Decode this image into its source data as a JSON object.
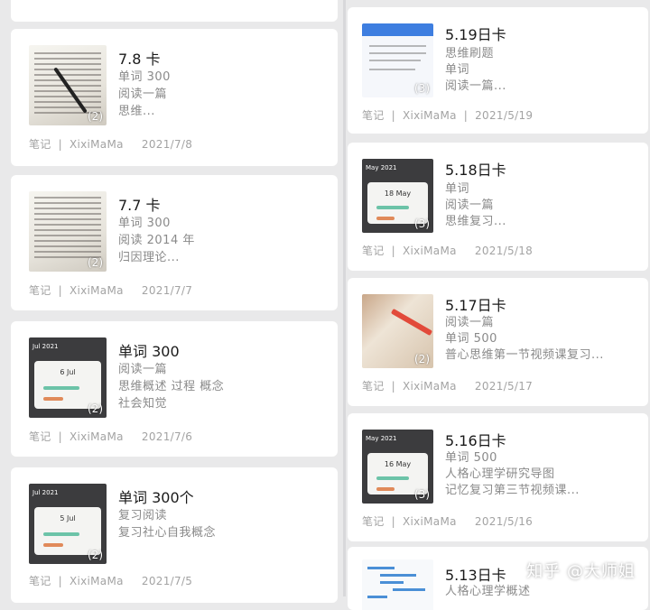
{
  "left_cards": [
    {
      "title": "7.8 卡",
      "lines": [
        "单词 300",
        "阅读一篇",
        "思维..."
      ],
      "badge": "(2)",
      "thumb": "paper-with-pen",
      "meta": {
        "type": "笔记",
        "author": "XixiMaMa",
        "date": "2021/7/8"
      }
    },
    {
      "title": "7.7 卡",
      "lines": [
        "单词 300",
        "阅读 2014 年",
        "归因理论..."
      ],
      "badge": "(2)",
      "thumb": "paper-text",
      "meta": {
        "type": "笔记",
        "author": "XixiMaMa",
        "date": "2021/7/7"
      }
    },
    {
      "title": "单词 300",
      "lines": [
        "阅读一篇",
        "思维概述 过程 概念",
        "社会知觉"
      ],
      "badge": "(2)",
      "thumb": "app-screenshot",
      "thumb_header": "Jul 2021",
      "thumb_date": "6 Jul",
      "meta": {
        "type": "笔记",
        "author": "XixiMaMa",
        "date": "2021/7/6"
      }
    },
    {
      "title": "单词 300个",
      "lines": [
        "复习阅读",
        "复习社心自我概念"
      ],
      "badge": "(2)",
      "thumb": "app-screenshot",
      "thumb_header": "Jul 2021",
      "thumb_date": "5 Jul",
      "meta": {
        "type": "笔记",
        "author": "XixiMaMa",
        "date": "2021/7/5"
      }
    }
  ],
  "right_cards": [
    {
      "title": "5.19日卡",
      "lines": [
        "思维刷题",
        "单词",
        "阅读一篇..."
      ],
      "badge": "(3)",
      "thumb": "blue-app",
      "meta": {
        "type": "笔记",
        "author": "XixiMaMa",
        "date": "2021/5/19"
      }
    },
    {
      "title": "5.18日卡",
      "lines": [
        "单词",
        "阅读一篇",
        "思维复习..."
      ],
      "badge": "(3)",
      "thumb": "app-screenshot",
      "thumb_header": "May 2021",
      "thumb_date": "18 May",
      "meta": {
        "type": "笔记",
        "author": "XixiMaMa",
        "date": "2021/5/18"
      }
    },
    {
      "title": "5.17日卡",
      "lines": [
        "阅读一篇",
        "单词 500",
        "普心思维第一节视频课复习..."
      ],
      "badge": "(2)",
      "thumb": "book-photo",
      "meta": {
        "type": "笔记",
        "author": "XixiMaMa",
        "date": "2021/5/17"
      }
    },
    {
      "title": "5.16日卡",
      "lines": [
        "单词 500",
        "人格心理学研究导图",
        "记忆复习第三节视频课..."
      ],
      "badge": "(3)",
      "thumb": "app-screenshot",
      "thumb_header": "May 2021",
      "thumb_date": "16 May",
      "meta": {
        "type": "笔记",
        "author": "XixiMaMa",
        "date": "2021/5/16"
      }
    },
    {
      "title": "5.13日卡",
      "lines": [
        "人格心理学概述"
      ],
      "badge": "",
      "thumb": "mind-map",
      "meta": {
        "type": "",
        "author": "",
        "date": ""
      }
    }
  ],
  "watermark": "知乎 @大师姐"
}
